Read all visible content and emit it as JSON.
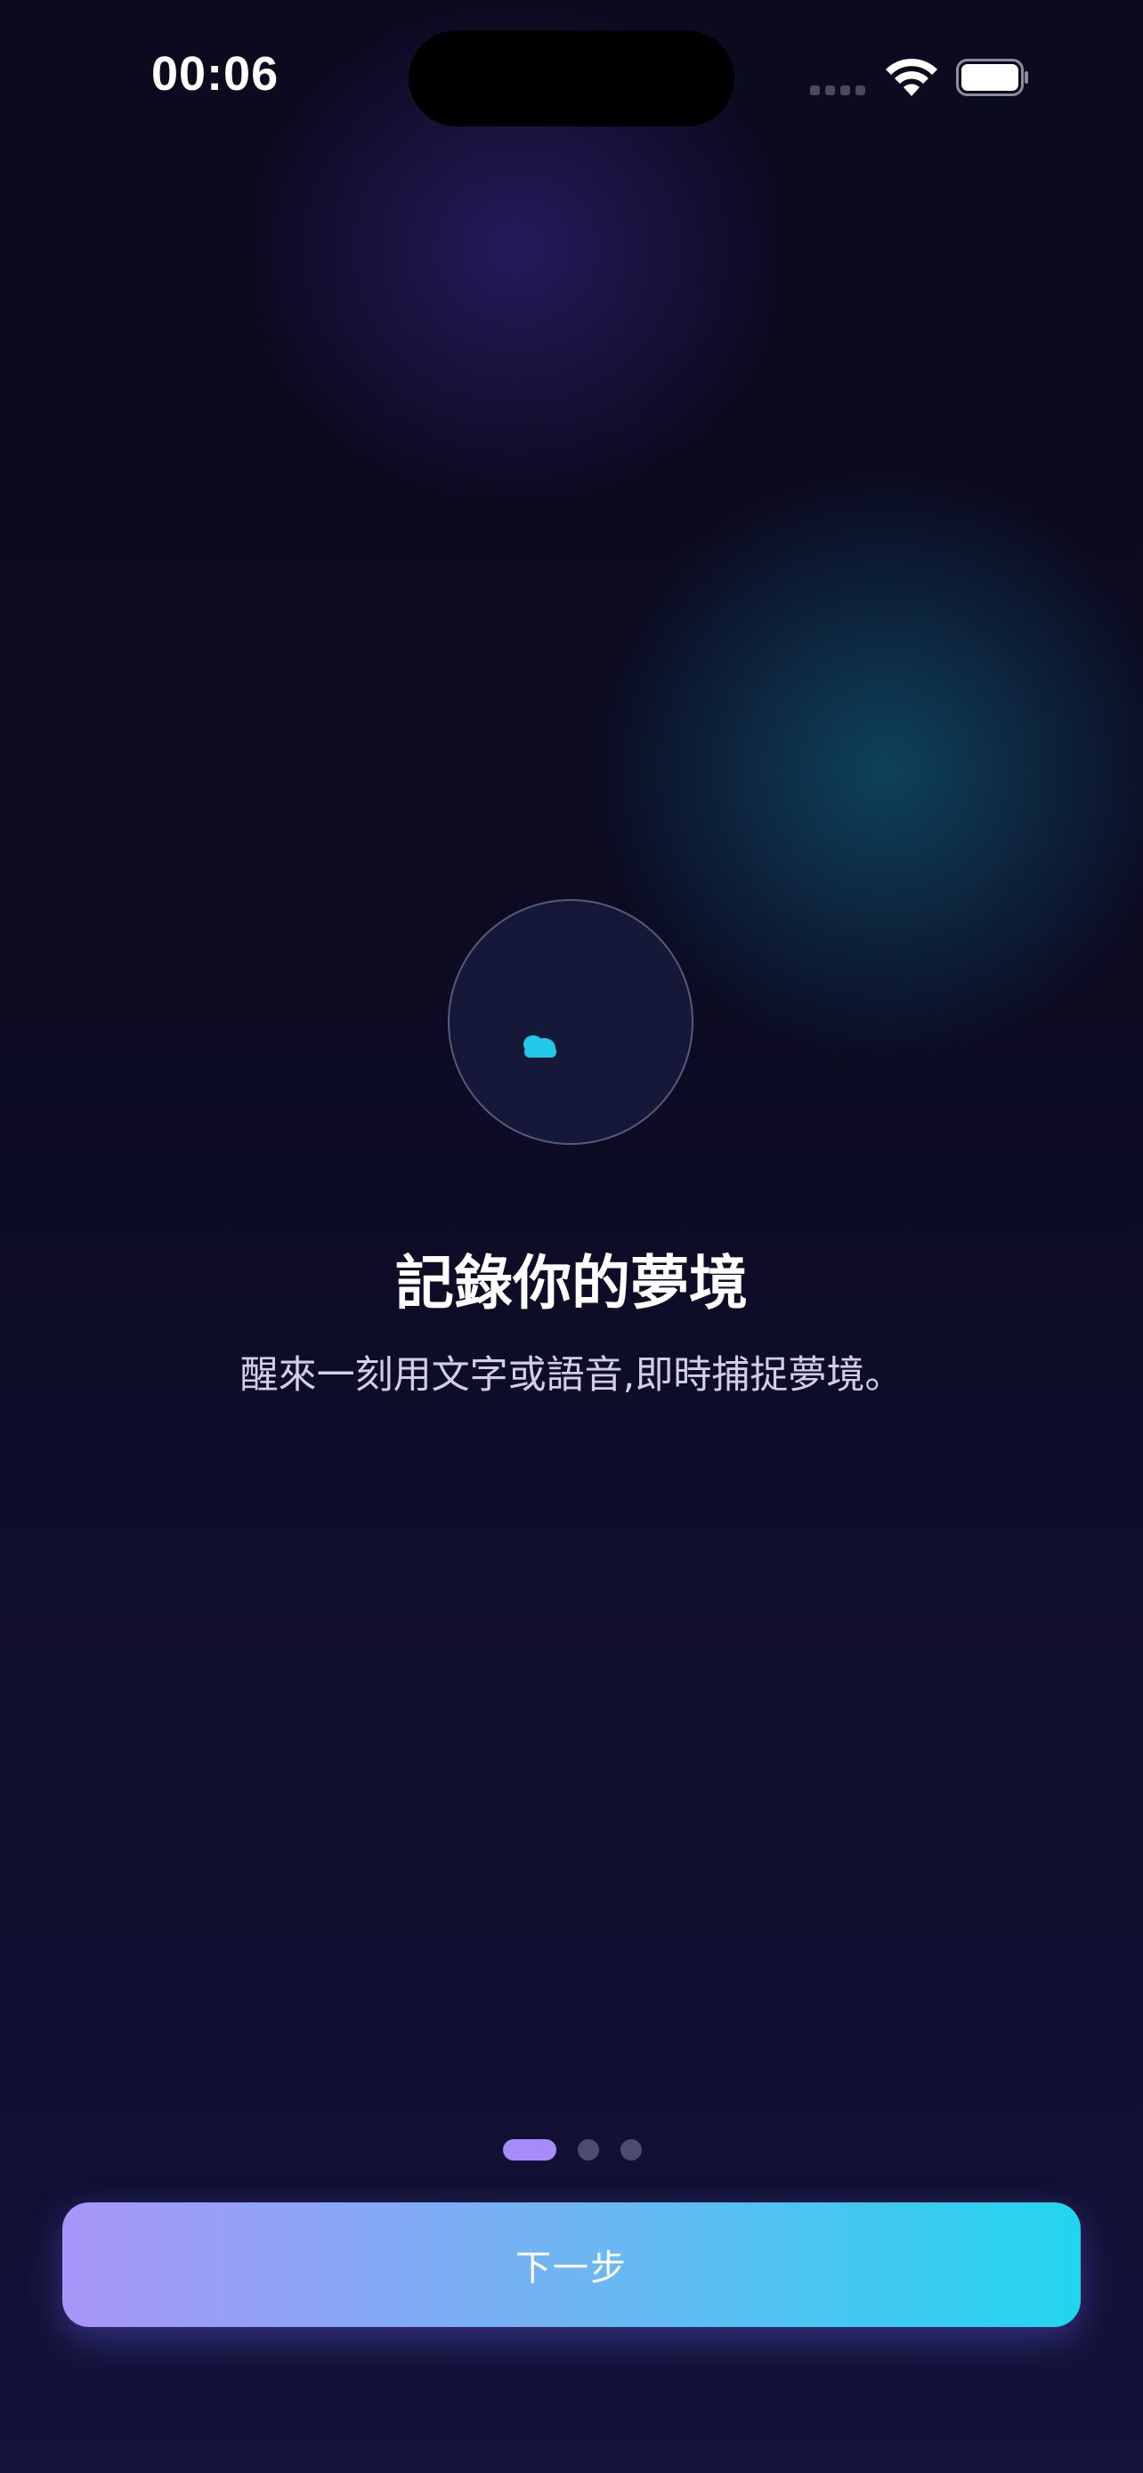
{
  "status_bar": {
    "time": "00:06"
  },
  "onboarding": {
    "icon": "moon-cloud-icon",
    "title": "記錄你的夢境",
    "subtitle": "醒來一刻用文字或語音,即時捕捉夢境。"
  },
  "pagination": {
    "current_page": 1,
    "total_pages": 3
  },
  "next_button": {
    "label": "下一步"
  },
  "colors": {
    "accent_purple": "#a78bfa",
    "accent_cyan": "#22d3ee",
    "background": "#0d0d24"
  }
}
